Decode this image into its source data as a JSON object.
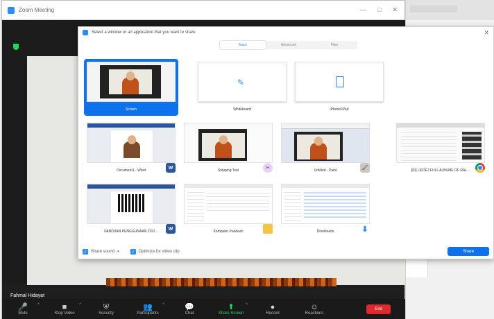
{
  "window": {
    "title": "Zoom Meeting",
    "controls": [
      "—",
      "□",
      "✕"
    ]
  },
  "share_dialog": {
    "title": "Select a window or an application that you want to share",
    "close": "✕",
    "tabs": [
      {
        "label": "Basic",
        "active": true
      },
      {
        "label": "Advanced",
        "active": false
      },
      {
        "label": "Files",
        "active": false
      }
    ],
    "tiles": [
      {
        "caption": "Screen",
        "selected": true
      },
      {
        "caption": "Whiteboard"
      },
      {
        "caption": "iPhone/iPad"
      },
      {
        "caption": "Document1 - Word",
        "icon": "word-icon",
        "icon_glyph": "W"
      },
      {
        "caption": "Snipping Tool",
        "icon": "snipping-tool-icon",
        "icon_glyph": "✂"
      },
      {
        "caption": "Untitled - Paint",
        "icon": "paint-icon",
        "icon_glyph": "🖌"
      },
      {
        "caption": "[ID] LIRTEJ FULL ALBUME OF RAL...",
        "icon": "chrome-icon",
        "icon_glyph": ""
      },
      {
        "caption": "PANDUAN PENGGUNAAN ZOO...",
        "icon": "word-icon",
        "icon_glyph": "W"
      },
      {
        "caption": "Komputer Pandean",
        "icon": "folder-icon",
        "icon_glyph": ""
      },
      {
        "caption": "Downloads",
        "icon": "download-icon",
        "icon_glyph": "⬇"
      }
    ],
    "share_sound": "Share sound",
    "optimize": "Optimize for video clip",
    "share_button": "Share"
  },
  "participant_name": "Fahmal Hidayat",
  "toolbar": [
    {
      "label": "Mute",
      "icon": "microphone-icon",
      "glyph": "🎤",
      "caret": true
    },
    {
      "label": "Stop Video",
      "icon": "camera-icon",
      "glyph": "■",
      "caret": true
    },
    {
      "label": "Security",
      "icon": "shield-icon",
      "glyph": "⛨",
      "caret": false
    },
    {
      "label": "Participants",
      "icon": "participants-icon",
      "glyph": "👥",
      "caret": true
    },
    {
      "label": "Chat",
      "icon": "chat-icon",
      "glyph": "💬",
      "caret": false
    },
    {
      "label": "Share Screen",
      "icon": "share-screen-icon",
      "glyph": "⬆",
      "caret": true
    },
    {
      "label": "Record",
      "icon": "record-icon",
      "glyph": "●",
      "caret": false
    },
    {
      "label": "Reactions",
      "icon": "reactions-icon",
      "glyph": "☺",
      "caret": false
    }
  ],
  "end_button": "End"
}
